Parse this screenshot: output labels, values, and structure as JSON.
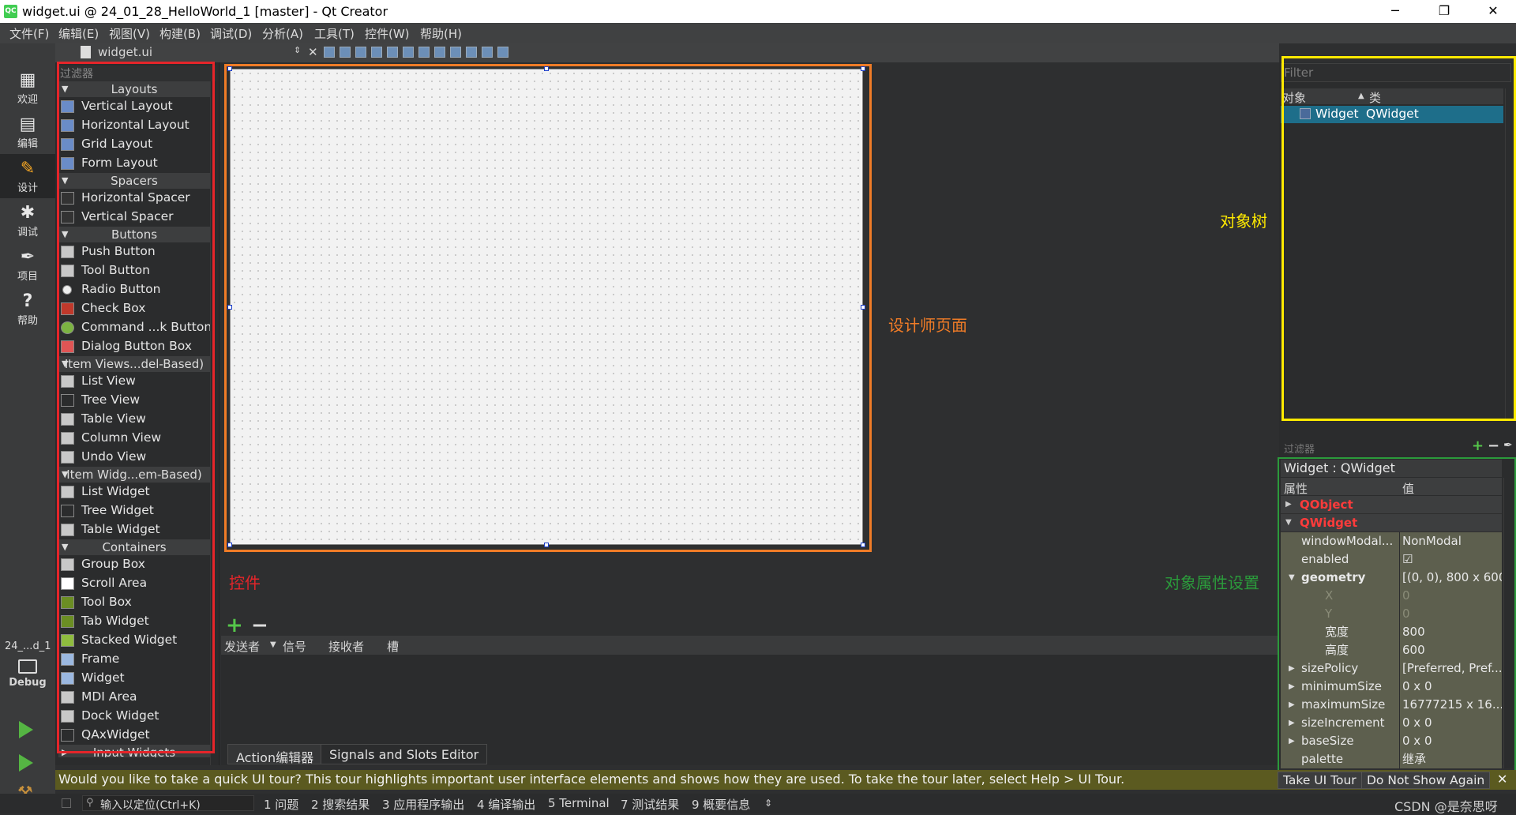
{
  "window": {
    "title": "widget.ui @ 24_01_28_HelloWorld_1 [master] - Qt Creator",
    "app_icon": "QC",
    "minimize": "─",
    "maximize": "❐",
    "close": "✕"
  },
  "menu": [
    "文件(F)",
    "编辑(E)",
    "视图(V)",
    "构建(B)",
    "调试(D)",
    "分析(A)",
    "工具(T)",
    "控件(W)",
    "帮助(H)"
  ],
  "modes": [
    {
      "icon": "grid-icon",
      "glyph": "▦",
      "label": "欢迎"
    },
    {
      "icon": "edit-icon",
      "glyph": "▤",
      "label": "编辑"
    },
    {
      "icon": "pencil-icon",
      "glyph": "✎",
      "label": "设计"
    },
    {
      "icon": "bug-icon",
      "glyph": "✱",
      "label": "调试"
    },
    {
      "icon": "wrench-icon",
      "glyph": "✒",
      "label": "项目"
    },
    {
      "icon": "help-icon",
      "glyph": "?",
      "label": "帮助"
    }
  ],
  "kit": {
    "project": "24_...d_1",
    "mode": "Debug"
  },
  "editor": {
    "file_name": "widget.ui"
  },
  "widget_box": {
    "filter_placeholder": "过滤器",
    "categories": {
      "layouts": "Layouts",
      "spacers": "Spacers",
      "buttons": "Buttons",
      "item_views": "Item Views...del-Based)",
      "item_widgets": "Item Widg...em-Based)",
      "containers": "Containers",
      "input_widgets": "Input Widgets"
    },
    "layouts": [
      "Vertical Layout",
      "Horizontal Layout",
      "Grid Layout",
      "Form Layout"
    ],
    "spacers": [
      "Horizontal Spacer",
      "Vertical Spacer"
    ],
    "buttons": [
      "Push Button",
      "Tool Button",
      "Radio Button",
      "Check Box",
      "Command ...k Button",
      "Dialog Button Box"
    ],
    "item_views": [
      "List View",
      "Tree View",
      "Table View",
      "Column View",
      "Undo View"
    ],
    "item_widgets": [
      "List Widget",
      "Tree Widget",
      "Table Widget"
    ],
    "containers": [
      "Group Box",
      "Scroll Area",
      "Tool Box",
      "Tab Widget",
      "Stacked Widget",
      "Frame",
      "Widget",
      "MDI Area",
      "Dock Widget",
      "QAxWidget"
    ]
  },
  "annotations": {
    "widgets": "控件",
    "designer": "设计师页面",
    "object_tree": "对象树",
    "properties": "对象属性设置",
    "colors": {
      "red": "#e5252a",
      "orange": "#f07c27",
      "yellow": "#ffea00",
      "green": "#2b9a3b"
    }
  },
  "signals": {
    "columns": [
      "发送者",
      "信号",
      "接收者",
      "槽"
    ],
    "tabs": [
      "Action编辑器",
      "Signals and Slots Editor"
    ],
    "add": "+",
    "remove": "−"
  },
  "object_inspector": {
    "filter_placeholder": "Filter",
    "col_object": "对象",
    "col_class": "类",
    "rows": [
      {
        "object": "Widget",
        "class": "QWidget"
      }
    ]
  },
  "property_editor": {
    "filter_placeholder": "过滤器",
    "title": "Widget : QWidget",
    "col_property": "属性",
    "col_value": "值",
    "rows": [
      {
        "name": "QObject",
        "value": "",
        "kind": "grp"
      },
      {
        "name": "QWidget",
        "value": "",
        "kind": "grp"
      },
      {
        "name": "windowModal...",
        "value": "NonModal",
        "kind": "item"
      },
      {
        "name": "enabled",
        "value": "☑",
        "kind": "item"
      },
      {
        "name": "geometry",
        "value": "[(0, 0), 800 x 600]",
        "kind": "item"
      },
      {
        "name": "X",
        "value": "0",
        "kind": "dim"
      },
      {
        "name": "Y",
        "value": "0",
        "kind": "dim"
      },
      {
        "name": "宽度",
        "value": "800",
        "kind": "item"
      },
      {
        "name": "高度",
        "value": "600",
        "kind": "item"
      },
      {
        "name": "sizePolicy",
        "value": "[Preferred, Pref...",
        "kind": "item"
      },
      {
        "name": "minimumSize",
        "value": "0 x 0",
        "kind": "item"
      },
      {
        "name": "maximumSize",
        "value": "16777215 x 16...",
        "kind": "item"
      },
      {
        "name": "sizeIncrement",
        "value": "0 x 0",
        "kind": "item"
      },
      {
        "name": "baseSize",
        "value": "0 x 0",
        "kind": "item"
      },
      {
        "name": "palette",
        "value": "继承",
        "kind": "item"
      }
    ]
  },
  "tour": {
    "message": "Would you like to take a quick UI tour? This tour highlights important user interface elements and shows how they are used. To take the tour later, select Help > UI Tour.",
    "take_tour": "Take UI Tour",
    "dont_show": "Do Not Show Again",
    "close": "✕"
  },
  "status_bar": {
    "locator_placeholder": "输入以定位(Ctrl+K)",
    "panes": [
      "1 问题",
      "2 搜索结果",
      "3 应用程序输出",
      "4 编译输出",
      "5 Terminal",
      "7 测试结果",
      "9 概要信息"
    ],
    "watermark": "CSDN @是奈思呀"
  }
}
